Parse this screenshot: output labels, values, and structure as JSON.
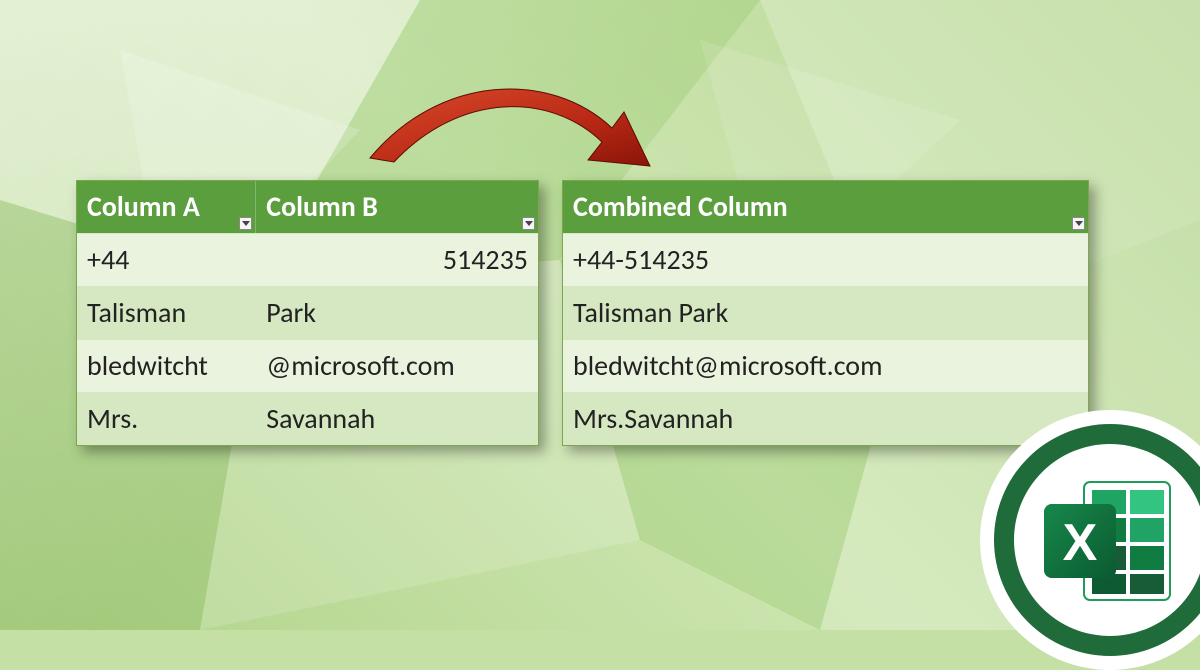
{
  "source": {
    "headers": {
      "a": "Column A",
      "b": "Column B"
    },
    "rows": [
      {
        "a": "+44",
        "b": "514235",
        "bRight": true
      },
      {
        "a": "Talisman",
        "b": "Park"
      },
      {
        "a": "bledwitcht",
        "b": "@microsoft.com"
      },
      {
        "a": "Mrs.",
        "b": "Savannah"
      }
    ]
  },
  "result": {
    "header": "Combined Column",
    "rows": [
      "+44-514235",
      "Talisman Park",
      "bledwitcht@microsoft.com",
      "Mrs.Savannah"
    ]
  },
  "icon": {
    "letter": "X"
  }
}
